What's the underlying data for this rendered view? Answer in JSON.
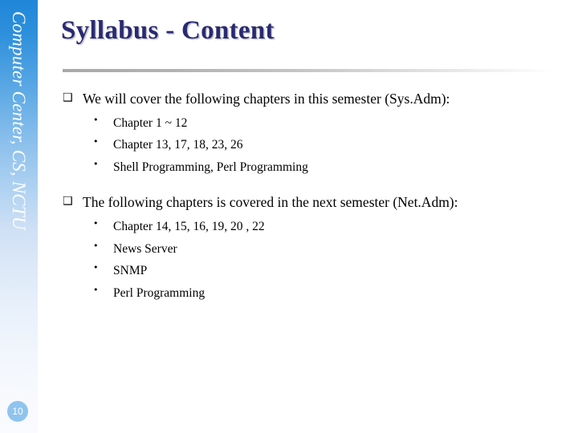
{
  "sidebar": {
    "vertical_label": "Computer Center, CS, NCTU",
    "page_number": "10",
    "gradient_top_color": "#1f86d8",
    "gradient_bottom_color": "#fafbfe",
    "badge_color": "#8fc4ee"
  },
  "header": {
    "title": "Syllabus - Content",
    "title_color": "#2a2a72",
    "rule_color": "#a9a9a9"
  },
  "content": {
    "bullet_marker_level1": "❑",
    "bullet_marker_level2": "•",
    "sections": [
      {
        "heading": "We will cover the following chapters in this semester (Sys.Adm):",
        "items": [
          "Chapter 1 ~ 12",
          "Chapter 13, 17, 18, 23, 26",
          "Shell Programming, Perl Programming"
        ]
      },
      {
        "heading": "The following chapters is covered in the next semester (Net.Adm):",
        "items": [
          "Chapter 14, 15, 16, 19, 20 , 22",
          "News Server",
          "SNMP",
          "Perl Programming"
        ]
      }
    ]
  }
}
